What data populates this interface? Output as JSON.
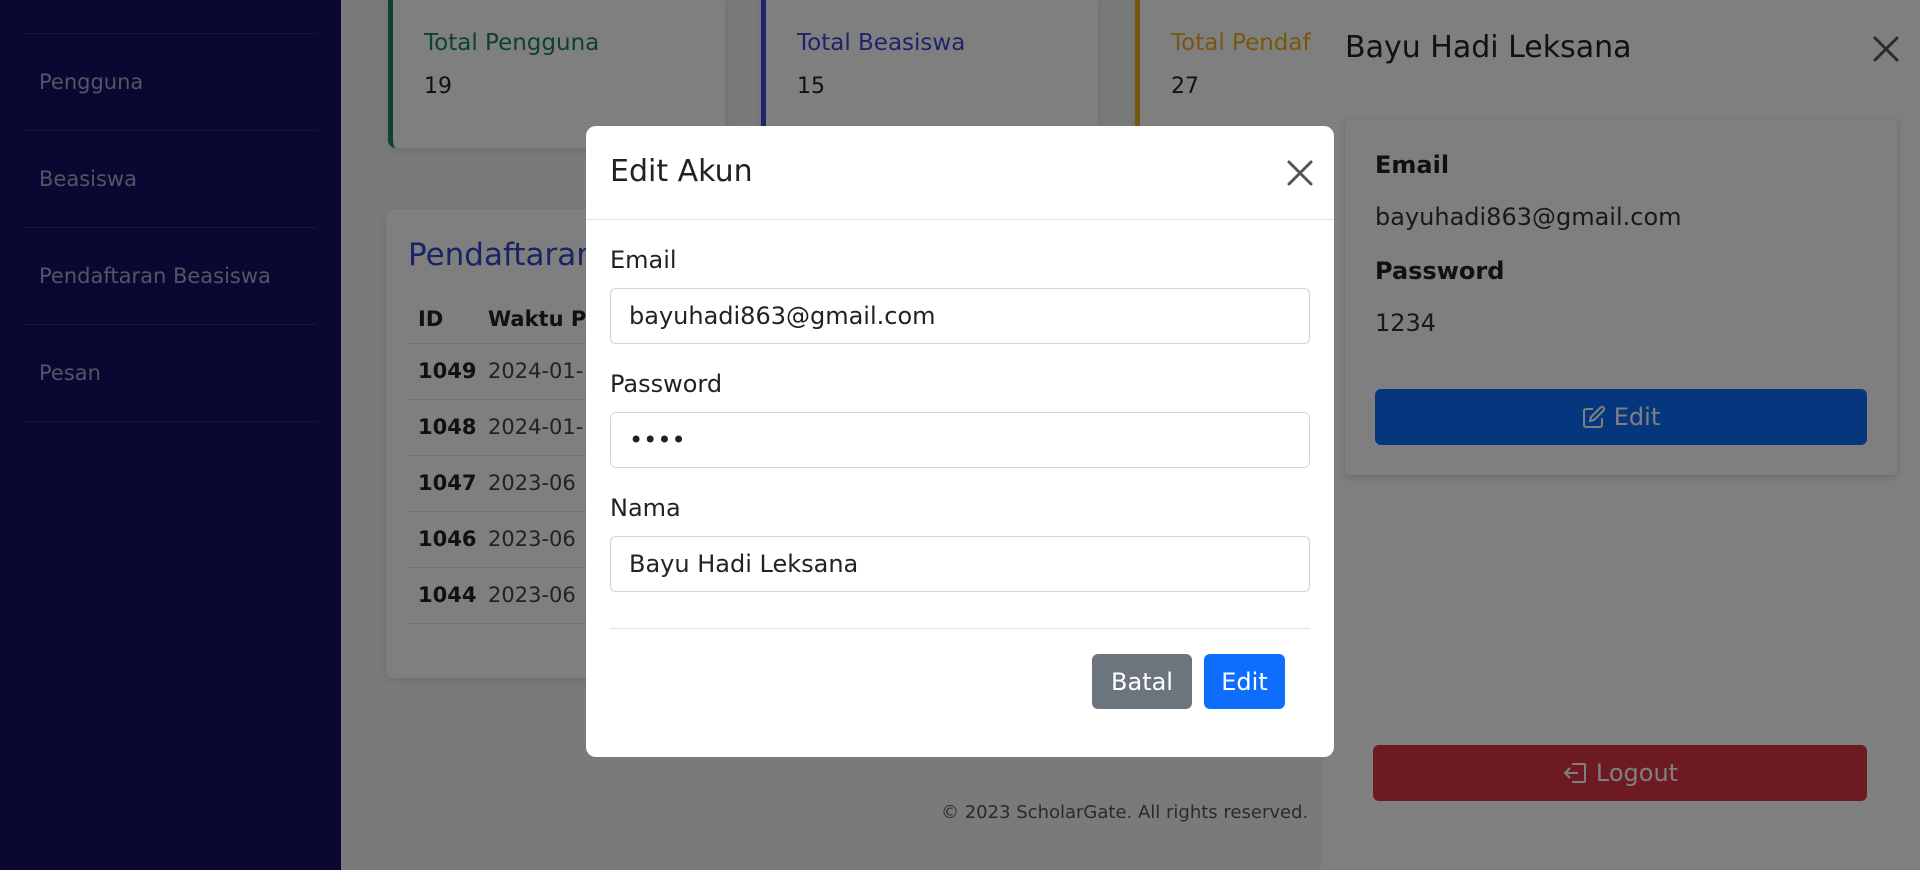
{
  "sidebar": {
    "items": [
      {
        "label": "Pengguna"
      },
      {
        "label": "Beasiswa"
      },
      {
        "label": "Pendaftaran Beasiswa"
      },
      {
        "label": "Pesan"
      }
    ]
  },
  "stats": [
    {
      "label": "Total Pengguna",
      "value": "19"
    },
    {
      "label": "Total Beasiswa",
      "value": "15"
    },
    {
      "label": "Total Pendaf",
      "value": "27"
    }
  ],
  "registrations": {
    "title": "Pendaftaran",
    "columns": [
      "ID",
      "Waktu P"
    ],
    "rows": [
      {
        "id": "1049",
        "time": "2024-01-"
      },
      {
        "id": "1048",
        "time": "2024-01-"
      },
      {
        "id": "1047",
        "time": "2023-06"
      },
      {
        "id": "1046",
        "time": "2023-06"
      },
      {
        "id": "1044",
        "time": "2023-06"
      }
    ]
  },
  "footer": {
    "text": "© 2023 ScholarGate. All rights reserved."
  },
  "panel": {
    "title": "Bayu Hadi Leksana",
    "email_label": "Email",
    "email": "bayuhadi863@gmail.com",
    "password_label": "Password",
    "password": "1234",
    "edit_label": "Edit",
    "logout_label": "Logout"
  },
  "modal": {
    "title": "Edit Akun",
    "email_label": "Email",
    "email_value": "bayuhadi863@gmail.com",
    "password_label": "Password",
    "password_value": "1234",
    "name_label": "Nama",
    "name_value": "Bayu Hadi Leksana",
    "cancel_label": "Batal",
    "submit_label": "Edit"
  },
  "colors": {
    "sidebar": "#111064",
    "primary": "#0d6efd",
    "danger": "#dc3545",
    "secondary": "#6c757d"
  }
}
